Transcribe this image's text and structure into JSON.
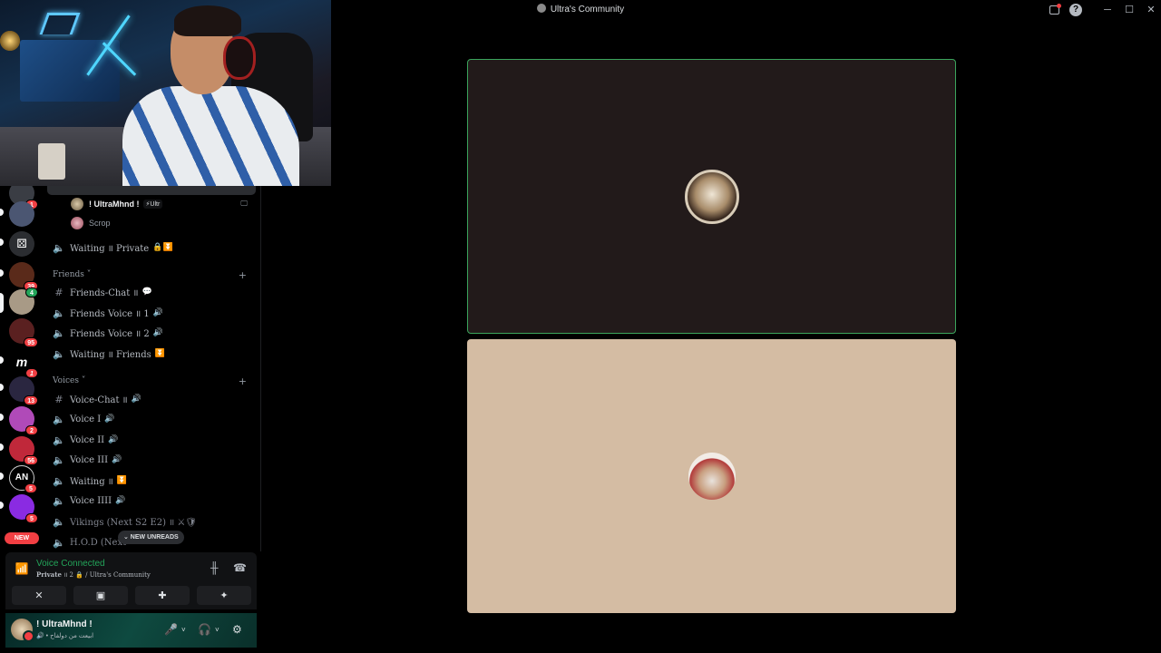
{
  "window": {
    "title": "Ultra's Community"
  },
  "rail": {
    "badges": [
      "1",
      "39",
      "4",
      "95",
      "1",
      "13",
      "2",
      "56",
      "5",
      "5"
    ],
    "new_label": "NEW"
  },
  "sidebar": {
    "users": [
      {
        "name": "! UltraMhnd !",
        "tag": "⚡Ultr",
        "highlight": true
      },
      {
        "name": "Scrop",
        "highlight": false
      }
    ],
    "channels_top": [
      {
        "name": "Waiting ॥ Private",
        "emoji": "🔒⏬",
        "type": "voice"
      }
    ],
    "categories": [
      {
        "name": "Friends ˅",
        "channels": [
          {
            "name": "Friends-Chat ॥",
            "emoji": "💬",
            "type": "text"
          },
          {
            "name": "Friends Voice ॥ 1",
            "emoji": "🔊",
            "type": "voice"
          },
          {
            "name": "Friends Voice ॥ 2",
            "emoji": "🔊",
            "type": "voice"
          },
          {
            "name": "Waiting ॥ Friends",
            "emoji": "⏬",
            "type": "voice"
          }
        ]
      },
      {
        "name": "Voices ˅",
        "channels": [
          {
            "name": "Voice-Chat ॥",
            "emoji": "🔊",
            "type": "text"
          },
          {
            "name": "Voice I",
            "emoji": "🔊",
            "type": "voice"
          },
          {
            "name": "Voice II",
            "emoji": "🔊",
            "type": "voice"
          },
          {
            "name": "Voice III",
            "emoji": "🔊",
            "type": "voice"
          },
          {
            "name": "Waiting ॥",
            "emoji": "⏬",
            "type": "voice"
          },
          {
            "name": "Voice IIII",
            "emoji": "🔊",
            "type": "voice"
          },
          {
            "name": "Vikings (Next S2 E2) ॥ ⚔🛡",
            "emoji": "",
            "type": "voice"
          },
          {
            "name": "H.O.D (Next",
            "emoji": "",
            "type": "voice"
          }
        ]
      }
    ],
    "new_unreads": "⌄ NEW UNREADS"
  },
  "voice": {
    "title": "Voice Connected",
    "subtitle_bold": "Private",
    "subtitle_rest": " ॥ 2 🔒 / Ultra's Community"
  },
  "user": {
    "name": "! UltraMhnd !",
    "status": "🔊 • ابيعت من دولفاح"
  },
  "colors": {
    "accent_green": "#23a55a",
    "badge_red": "#f23f43",
    "tile_border": "#3ba55c"
  },
  "icons": {
    "camera_off": "✕",
    "screen_share": "▣",
    "activities": "✚",
    "soundboard": "✦",
    "soundwave": "╫",
    "disconnect": "☎",
    "mic": "🎤",
    "headphones": "🎧",
    "settings": "⚙"
  }
}
